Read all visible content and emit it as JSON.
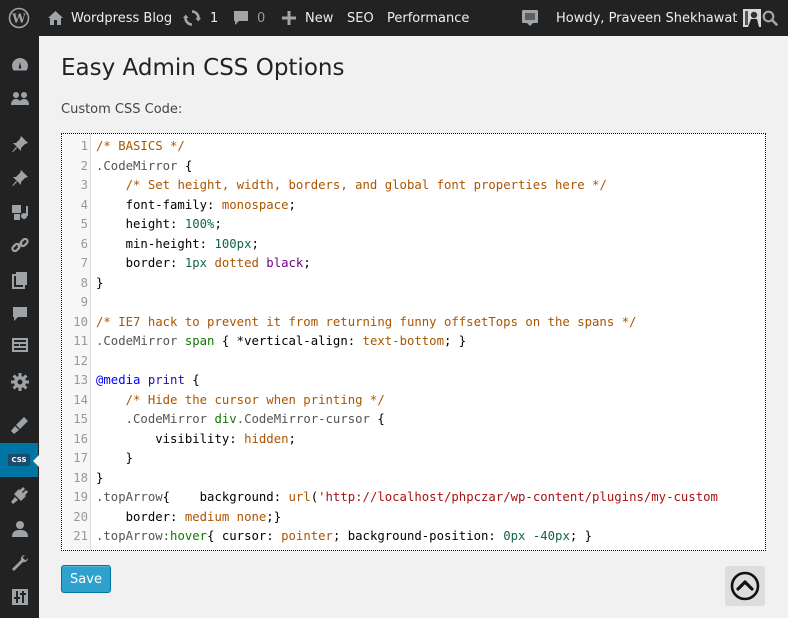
{
  "adminbar": {
    "site_name": "Wordpress Blog",
    "updates_count": "1",
    "comments_count": "0",
    "new_label": "New",
    "seo_label": "SEO",
    "performance_label": "Performance",
    "howdy": "Howdy, Praveen Shekhawat"
  },
  "page": {
    "title": "Easy Admin CSS Options",
    "css_label": "Custom CSS Code:",
    "save_label": "Save"
  },
  "sidebar": {
    "active_item": "css-icon",
    "css_badge": "CSS"
  },
  "code_lines": [
    [
      [
        "c-comment",
        "/* BASICS */"
      ]
    ],
    [
      [
        "c-qual",
        ".CodeMirror"
      ],
      [
        "",
        " {"
      ]
    ],
    [
      [
        "",
        "    "
      ],
      [
        "c-comment",
        "/* Set height, width, borders, and global font properties here */"
      ]
    ],
    [
      [
        "",
        "    font-family: "
      ],
      [
        "c-comment",
        "monospace"
      ],
      [
        "",
        ";"
      ]
    ],
    [
      [
        "",
        "    height: "
      ],
      [
        "c-number",
        "100%"
      ],
      [
        "",
        ";"
      ]
    ],
    [
      [
        "",
        "    min-height: "
      ],
      [
        "c-number",
        "100px"
      ],
      [
        "",
        ";"
      ]
    ],
    [
      [
        "",
        "    border: "
      ],
      [
        "c-number",
        "1px"
      ],
      [
        "",
        " "
      ],
      [
        "c-comment",
        "dotted"
      ],
      [
        "",
        " "
      ],
      [
        "c-keyword",
        "black"
      ],
      [
        "",
        ";"
      ]
    ],
    [
      [
        "",
        "}"
      ]
    ],
    [
      [
        "",
        ""
      ]
    ],
    [
      [
        "c-comment",
        "/* IE7 hack to prevent it from returning funny offsetTops on the spans */"
      ]
    ],
    [
      [
        "c-qual",
        ".CodeMirror"
      ],
      [
        "",
        " "
      ],
      [
        "c-tag",
        "span"
      ],
      [
        "",
        " { *vertical-align: "
      ],
      [
        "c-comment",
        "text-bottom"
      ],
      [
        "",
        "; }"
      ]
    ],
    [
      [
        "",
        ""
      ]
    ],
    [
      [
        "c-def",
        "@media"
      ],
      [
        "",
        " "
      ],
      [
        "c-atom",
        "print"
      ],
      [
        "",
        " {"
      ]
    ],
    [
      [
        "",
        "    "
      ],
      [
        "c-comment",
        "/* Hide the cursor when printing */"
      ]
    ],
    [
      [
        "",
        "    "
      ],
      [
        "c-qual",
        ".CodeMirror"
      ],
      [
        "",
        " "
      ],
      [
        "c-tag",
        "div"
      ],
      [
        "c-qual",
        ".CodeMirror-cursor"
      ],
      [
        "",
        " {"
      ]
    ],
    [
      [
        "",
        "        visibility: "
      ],
      [
        "c-comment",
        "hidden"
      ],
      [
        "",
        ";"
      ]
    ],
    [
      [
        "",
        "    }"
      ]
    ],
    [
      [
        "",
        "}"
      ]
    ],
    [
      [
        "c-qual",
        ".topArrow"
      ],
      [
        "",
        "{    background: "
      ],
      [
        "c-comment",
        "url"
      ],
      [
        "",
        "("
      ],
      [
        "c-string",
        "'http://localhost/phpczar/wp-content/plugins/my-custom"
      ]
    ],
    [
      [
        "",
        "    border: "
      ],
      [
        "c-comment",
        "medium"
      ],
      [
        "",
        " "
      ],
      [
        "c-comment",
        "none"
      ],
      [
        "",
        ";}"
      ]
    ],
    [
      [
        "c-qual",
        ".topArrow"
      ],
      [
        "c-tag",
        ":hover"
      ],
      [
        "",
        "{ cursor: "
      ],
      [
        "c-comment",
        "pointer"
      ],
      [
        "",
        "; background-position: "
      ],
      [
        "c-number",
        "0px"
      ],
      [
        "",
        " "
      ],
      [
        "c-number",
        "-40px"
      ],
      [
        "",
        "; }"
      ]
    ]
  ],
  "colors": {
    "adminbar_bg": "#222222",
    "accent": "#0074a2",
    "save_button": "#2ea2cc"
  }
}
